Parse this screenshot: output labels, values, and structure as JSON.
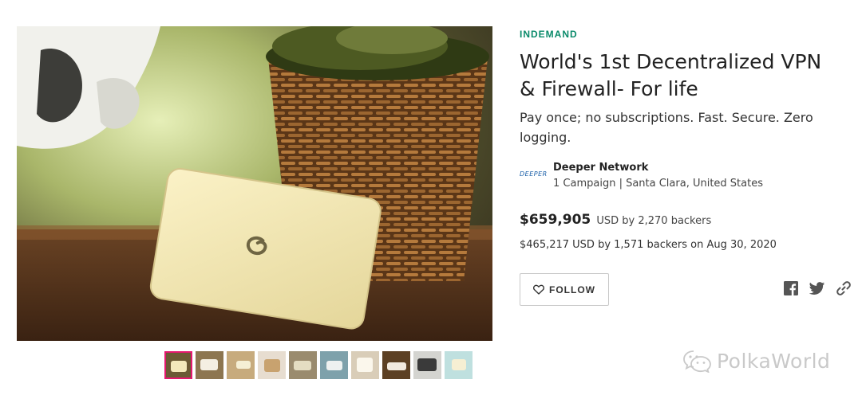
{
  "campaign": {
    "category": "INDEMAND",
    "title_line1": "World's 1st Decentralized VPN",
    "title_line2": "& Firewall- For life",
    "subtitle_line1": "Pay once; no subscriptions. Fast. Secure. Zero",
    "subtitle_line2": "logging."
  },
  "owner": {
    "logo_text": "DEEPER",
    "name": "Deeper Network",
    "meta": "1 Campaign | Santa Clara, United States"
  },
  "funding": {
    "amount": "$659,905",
    "suffix": "USD by 2,270 backers",
    "previous": "$465,217 USD by 1,571 backers on Aug 30, 2020"
  },
  "actions": {
    "follow_label": "FOLLOW"
  },
  "share_icons": [
    "facebook-icon",
    "twitter-icon",
    "link-icon"
  ],
  "thumbnails": {
    "count": 10,
    "active_index": 0,
    "active_color": "#e5186f"
  },
  "watermark": {
    "text": "PolkaWorld"
  },
  "colors": {
    "category": "#0a8a6a",
    "accent": "#e5186f"
  }
}
